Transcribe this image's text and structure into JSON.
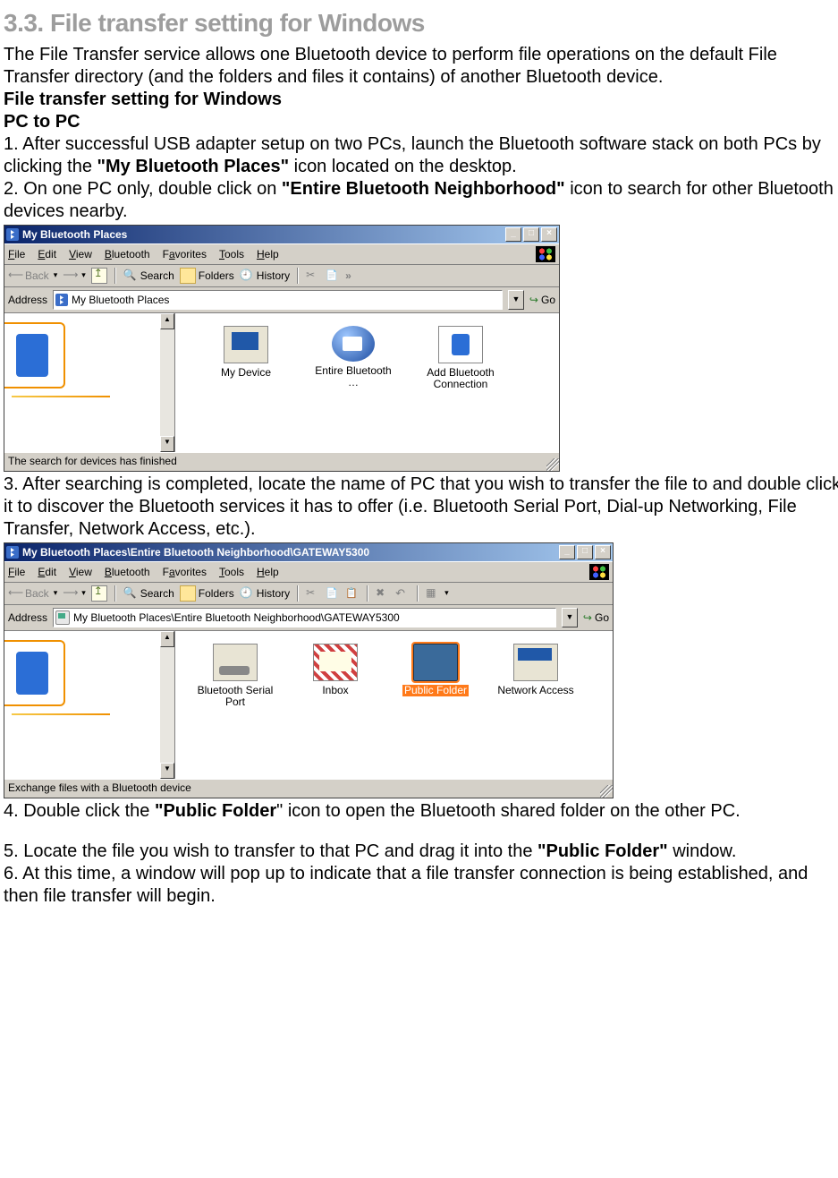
{
  "heading": "3.3. File transfer setting for Windows",
  "intro": "The File Transfer service allows one Bluetooth device to perform file operations on the default File Transfer directory (and the folders and files it contains) of another Bluetooth device.",
  "sub1": "File transfer setting for Windows",
  "sub2": "PC to PC",
  "step1_a": "1. After successful USB adapter setup on two PCs, launch the Bluetooth software stack on both PCs by clicking the ",
  "step1_b": "\"My Bluetooth Places\"",
  "step1_c": " icon located on the desktop.",
  "step2_a": "2. On one PC only, double click on ",
  "step2_b": "\"Entire Bluetooth Neighborhood\"",
  "step2_c": " icon to search for other Bluetooth devices nearby.",
  "step3": "3. After searching is completed, locate the name of PC that you wish to transfer the file to and double click it to discover the Bluetooth services it has to offer (i.e. Bluetooth Serial Port, Dial-up Networking, File Transfer, Network Access, etc.).",
  "step4_a": "4. Double click the ",
  "step4_b": "\"Public Folder",
  "step4_c": "\" icon to open the Bluetooth shared folder on the other PC.",
  "step5_a": "5. Locate the file you wish to transfer to that PC and drag it into the ",
  "step5_b": "\"Public Folder\"",
  "step5_c": " window.",
  "step6": "6. At this time, a window will pop up to indicate that a file transfer connection is being established, and then file transfer will begin.",
  "win1": {
    "title": "My Bluetooth Places",
    "menu": {
      "file": "File",
      "edit": "Edit",
      "view": "View",
      "bluetooth": "Bluetooth",
      "favorites": "Favorites",
      "tools": "Tools",
      "help": "Help"
    },
    "toolbar": {
      "back": "Back",
      "search": "Search",
      "folders": "Folders",
      "history": "History",
      "overflow": "»"
    },
    "address": {
      "label": "Address",
      "value": "My Bluetooth Places",
      "go": "Go"
    },
    "items": [
      {
        "name": "My Device"
      },
      {
        "name": "Entire Bluetooth …"
      },
      {
        "name": "Add Bluetooth Connection"
      }
    ],
    "status": "The search for devices has finished"
  },
  "win2": {
    "title": "My Bluetooth Places\\Entire Bluetooth Neighborhood\\GATEWAY5300",
    "menu": {
      "file": "File",
      "edit": "Edit",
      "view": "View",
      "bluetooth": "Bluetooth",
      "favorites": "Favorites",
      "tools": "Tools",
      "help": "Help"
    },
    "toolbar": {
      "back": "Back",
      "search": "Search",
      "folders": "Folders",
      "history": "History"
    },
    "address": {
      "label": "Address",
      "value": "My Bluetooth Places\\Entire Bluetooth Neighborhood\\GATEWAY5300",
      "go": "Go"
    },
    "items": [
      {
        "name": "Bluetooth Serial Port"
      },
      {
        "name": "Inbox"
      },
      {
        "name": "Public Folder"
      },
      {
        "name": "Network Access"
      }
    ],
    "status": "Exchange files with a Bluetooth device"
  }
}
